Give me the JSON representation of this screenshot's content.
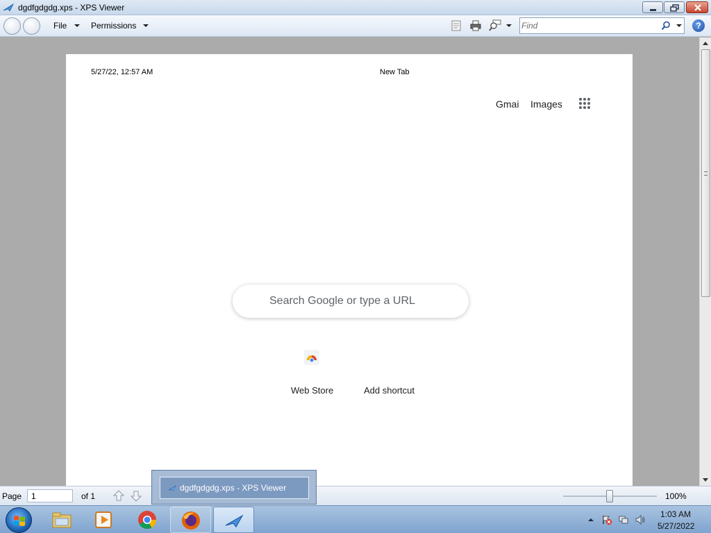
{
  "window": {
    "title": "dgdfgdgdg.xps - XPS Viewer"
  },
  "toolbar": {
    "menu_file": "File",
    "menu_permissions": "Permissions",
    "find_placeholder": "Find",
    "icons": [
      "back-icon",
      "forward-icon",
      "document-icon",
      "print-icon",
      "zoom-icon",
      "search-icon",
      "help-icon"
    ]
  },
  "document": {
    "header_datetime": "5/27/22, 12:57 AM",
    "header_title": "New Tab",
    "links": {
      "gmail": "Gmai",
      "images": "Images"
    },
    "search_placeholder": "Search Google or type a URL",
    "shortcuts": [
      {
        "label": "Web Store"
      },
      {
        "label": "Add shortcut"
      }
    ]
  },
  "statusbar": {
    "page_label": "Page",
    "page_value": "1",
    "of_label": "of 1",
    "zoom_label": "100%",
    "zoom_fraction": 0.5
  },
  "taskbar": {
    "preview_title": "dgdfgdgdg.xps - XPS Viewer",
    "clock_time": "1:03 AM",
    "clock_date": "5/27/2022",
    "apps": [
      "windows-explorer-icon",
      "media-player-icon",
      "chrome-icon",
      "firefox-icon",
      "xps-viewer-icon"
    ]
  }
}
